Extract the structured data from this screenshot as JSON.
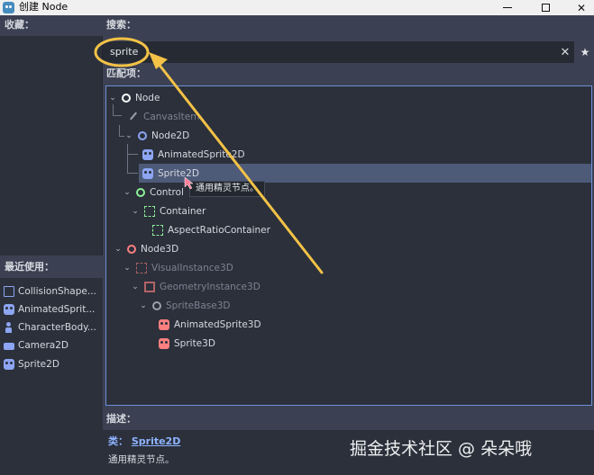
{
  "window": {
    "title": "创建 Node",
    "minimize_label": "—",
    "maximize_label": "□",
    "close_label": "✕"
  },
  "favorites": {
    "header": "收藏："
  },
  "recent": {
    "header": "最近使用：",
    "items": [
      {
        "label": "CollisionShape...",
        "icon": "collision-shape-icon"
      },
      {
        "label": "AnimatedSprit...",
        "icon": "animated-sprite-icon"
      },
      {
        "label": "CharacterBody...",
        "icon": "character-body-icon"
      },
      {
        "label": "Camera2D",
        "icon": "camera-icon"
      },
      {
        "label": "Sprite2D",
        "icon": "sprite-icon"
      }
    ]
  },
  "search": {
    "label": "搜索：",
    "value": "sprite",
    "clear_label": "✕",
    "favorite_label": "★"
  },
  "matches": {
    "label": "匹配项：",
    "tree": [
      {
        "label": "Node",
        "icon": "node-icon",
        "state": "normal"
      },
      {
        "label": "CanvasItem",
        "icon": "canvas-item-icon",
        "state": "dim"
      },
      {
        "label": "Node2D",
        "icon": "node2d-icon",
        "state": "normal"
      },
      {
        "label": "AnimatedSprite2D",
        "icon": "animated-sprite-2d-icon",
        "state": "normal"
      },
      {
        "label": "Sprite2D",
        "icon": "sprite-2d-icon",
        "state": "selected"
      },
      {
        "label": "Control",
        "icon": "control-icon",
        "state": "normal"
      },
      {
        "label": "Container",
        "icon": "container-icon",
        "state": "normal"
      },
      {
        "label": "AspectRatioContainer",
        "icon": "aspect-ratio-container-icon",
        "state": "normal"
      },
      {
        "label": "Node3D",
        "icon": "node3d-icon",
        "state": "normal"
      },
      {
        "label": "VisualInstance3D",
        "icon": "visual-instance-3d-icon",
        "state": "dim"
      },
      {
        "label": "GeometryInstance3D",
        "icon": "geometry-instance-3d-icon",
        "state": "dim"
      },
      {
        "label": "SpriteBase3D",
        "icon": "sprite-base-3d-icon",
        "state": "dim"
      },
      {
        "label": "AnimatedSprite3D",
        "icon": "animated-sprite-3d-icon",
        "state": "normal"
      },
      {
        "label": "Sprite3D",
        "icon": "sprite-3d-icon",
        "state": "normal"
      }
    ],
    "tooltip": "通用精灵节点。"
  },
  "description": {
    "label": "描述：",
    "class_prefix": "类：",
    "class_name": "Sprite2D",
    "text": "通用精灵节点。"
  },
  "watermark": "掘金技术社区 @ 朵朵哦",
  "colors": {
    "annotation": "#f3c246",
    "selection": "#4d5a78",
    "accent_border": "#6e8fd8"
  }
}
